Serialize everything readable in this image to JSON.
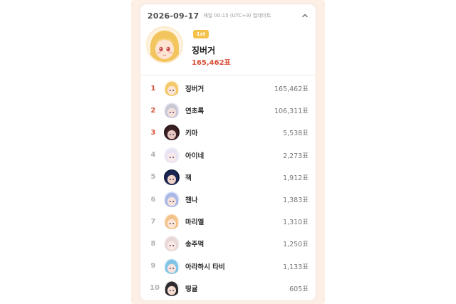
{
  "header": {
    "date": "2026-09-17",
    "update_note": "매일 00:15 (UTC+9) 업데이트",
    "collapse_icon": "chevron-up-icon"
  },
  "top": {
    "badge": "1st",
    "name": "징버거",
    "votes": "165,462표",
    "avatar_icon": "blonde-character-avatar"
  },
  "ranking": [
    {
      "rank": "1",
      "name": "징버거",
      "votes": "165,462표",
      "avatar": {
        "hair": "#f3c96a",
        "skin": "#fde4d3",
        "bg": "#fff4e1"
      }
    },
    {
      "rank": "2",
      "name": "연초록",
      "votes": "106,311표",
      "avatar": {
        "hair": "#c9c9d6",
        "skin": "#f6e0da",
        "bg": "#eceef6"
      }
    },
    {
      "rank": "3",
      "name": "키마",
      "votes": "5,538표",
      "avatar": {
        "hair": "#3a1f24",
        "skin": "#e7c6c0",
        "bg": "#2a1518"
      }
    },
    {
      "rank": "4",
      "name": "아이네",
      "votes": "2,273표",
      "avatar": {
        "hair": "#e9e4f4",
        "skin": "#fbeaea",
        "bg": "#f4f0fb"
      }
    },
    {
      "rank": "5",
      "name": "잭",
      "votes": "1,912표",
      "avatar": {
        "hair": "#1b2552",
        "skin": "#f0d4c8",
        "bg": "#101a3d"
      }
    },
    {
      "rank": "6",
      "name": "챈나",
      "votes": "1,383표",
      "avatar": {
        "hair": "#a9b9e6",
        "skin": "#f8e2dc",
        "bg": "#dfe6f8"
      }
    },
    {
      "rank": "7",
      "name": "마리엘",
      "votes": "1,310표",
      "avatar": {
        "hair": "#f2c38a",
        "skin": "#fde6d6",
        "bg": "#fff1e2"
      }
    },
    {
      "rank": "8",
      "name": "송주먹",
      "votes": "1,250표",
      "avatar": {
        "hair": "#e6d8d5",
        "skin": "#fbe8e4",
        "bg": "#f6eeee"
      }
    },
    {
      "rank": "9",
      "name": "아라하시 타비",
      "votes": "1,133표",
      "avatar": {
        "hair": "#7fc4e6",
        "skin": "#f8e4dc",
        "bg": "#e3f3fb"
      }
    },
    {
      "rank": "10",
      "name": "띵귤",
      "votes": "605표",
      "avatar": {
        "hair": "#2c2a2e",
        "skin": "#f6ddd0",
        "bg": "#f3efe8"
      }
    }
  ],
  "colors": {
    "accent": "#d9533b",
    "badge": "#f4c24b",
    "panel": "#fdeee6"
  }
}
